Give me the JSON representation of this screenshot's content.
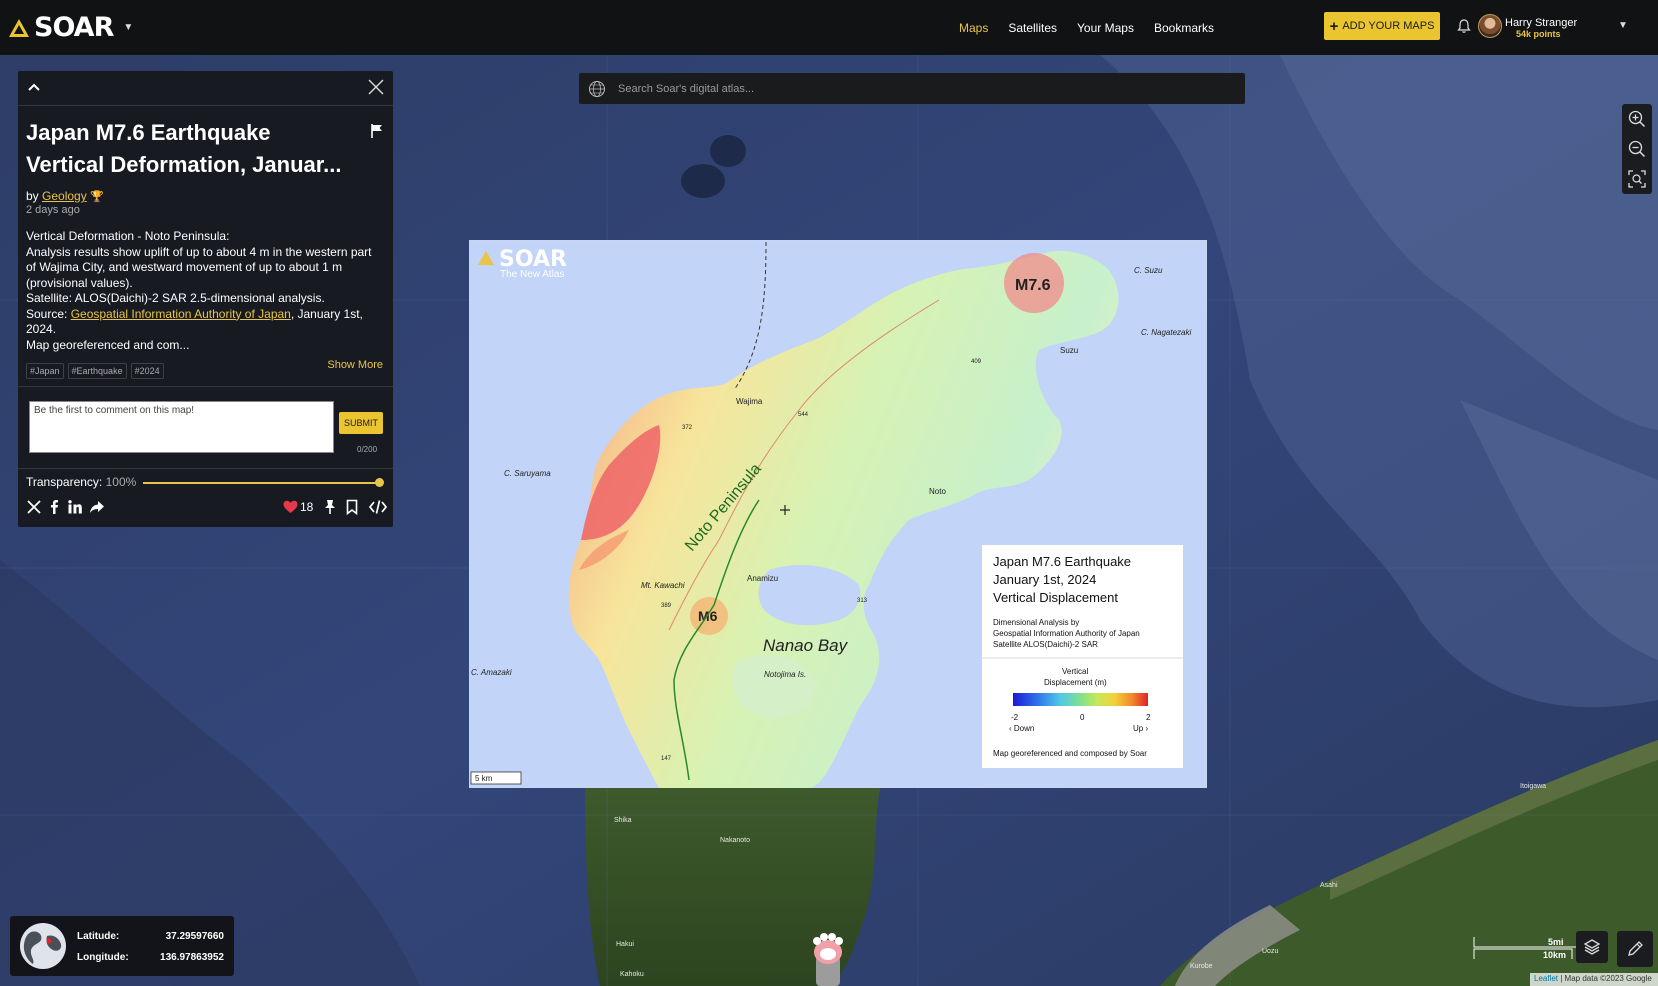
{
  "nav": {
    "logo": "SOAR",
    "links": [
      "Maps",
      "Satellites",
      "Your Maps",
      "Bookmarks"
    ],
    "add_button": "ADD YOUR MAPS",
    "user_name": "Harry Stranger",
    "user_points": "54k points"
  },
  "search": {
    "placeholder": "Search Soar's digital atlas..."
  },
  "panel": {
    "title_line1": "Japan M7.6 Earthquake",
    "title_line2": "Vertical Deformation, Januar...",
    "by_label": "by",
    "author": "Geology",
    "date": "2 days ago",
    "desc": {
      "line1": "Vertical Deformation - Noto Peninsula:",
      "line2": "Analysis results show uplift of up to about 4 m in the western part of Wajima City, and westward movement of up to about 1 m (provisional values).",
      "line3": "Satellite: ALOS(Daichi)-2 SAR 2.5-dimensional analysis.",
      "source_prefix": "Source: ",
      "source_link": "Geospatial Information Authority of Japan",
      "source_suffix": ", January 1st, 2024.",
      "line5": "Map georeferenced and com..."
    },
    "show_more": "Show More",
    "tags": [
      "#Japan",
      "#Earthquake",
      "#2024"
    ],
    "comment_placeholder": "Be the first to comment on this map!",
    "submit": "SUBMIT",
    "counter": "0/200",
    "transparency_label": "Transparency:",
    "transparency_value": "100%",
    "transparency_level": 1.0,
    "likes": "18"
  },
  "overlay": {
    "brand": "SOAR",
    "brand_sub": "The New Atlas",
    "peninsula_label": "Noto Peninsula",
    "bay_label": "Nanao Bay",
    "quake_main": "M7.6",
    "quake_minor": "M6",
    "places": {
      "c_suzu": "C. Suzu",
      "c_nagatezaki": "C. Nagatezaki",
      "suzu": "Suzu",
      "wajima": "Wajima",
      "c_saruyama": "C. Saruyama",
      "noto": "Noto",
      "anamizu": "Anamizu",
      "mt_kawachi": "Mt. Kawachi",
      "c_amazaki": "C. Amazaki",
      "notojima": "Notojima Is.",
      "e409": "409",
      "e372": "372",
      "e544": "544",
      "e389": "389",
      "e313": "313",
      "e147": "147"
    },
    "legend": {
      "title1": "Japan M7.6 Earthquake",
      "title2": "January 1st, 2024",
      "title3": "Vertical Displacement",
      "sub1": "Dimensional Analysis by",
      "sub2": "Geospatial Information Authority of Japan",
      "sub3": "Satellite ALOS(Daichi)-2 SAR",
      "scale_title1": "Vertical",
      "scale_title2": "Displacement (m)",
      "min": "-2",
      "mid": "0",
      "max": "2",
      "down": "‹ Down",
      "up": "Up ›",
      "footer": "Map georeferenced and composed by Soar"
    },
    "scale_bar": "5 km"
  },
  "coords": {
    "lat_label": "Latitude:",
    "lat": "37.29597660",
    "lon_label": "Longitude:",
    "lon": "136.97863952"
  },
  "basemap": {
    "scale_mi": "5mi",
    "scale_km": "10km",
    "attribution_leaflet": "Leaflet",
    "attribution_rest": " | Map data ©2023 Google",
    "towns": [
      "Shika",
      "Nakanoto",
      "Hakui",
      "Kahoku",
      "Kurobe",
      "Uozu",
      "Asahi",
      "Itoigawa"
    ]
  },
  "colors": {
    "accent": "#ebc530",
    "panel_bg": "#181a22",
    "topbar_bg": "#111214"
  }
}
